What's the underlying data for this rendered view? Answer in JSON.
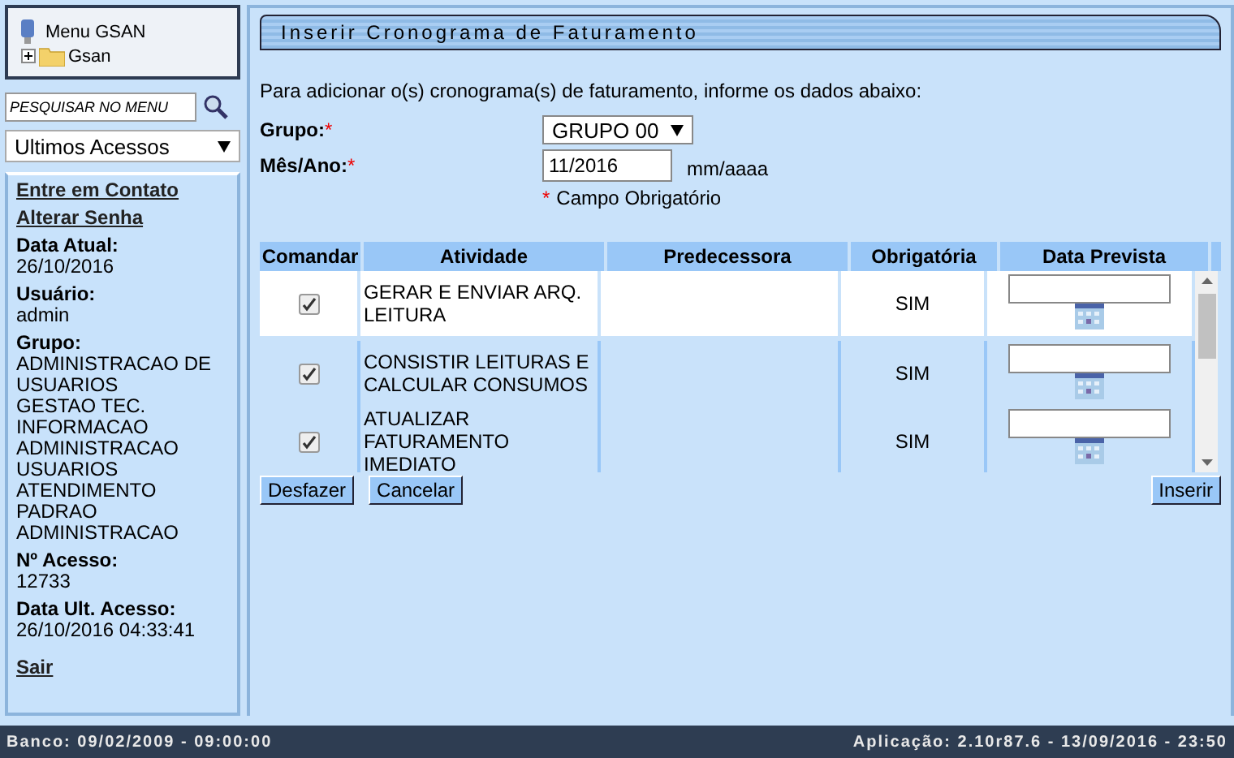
{
  "menu": {
    "title": "Menu GSAN",
    "tree": [
      {
        "label": "Gsan",
        "expanded": false
      }
    ]
  },
  "search": {
    "placeholder": "PESQUISAR NO MENU"
  },
  "recent": {
    "value": "Ultimos Acessos"
  },
  "links": [
    "Entre em Contato",
    "Alterar Senha"
  ],
  "info": [
    {
      "label": "Data Atual:",
      "lines": [
        "26/10/2016"
      ]
    },
    {
      "label": "Usuário:",
      "lines": [
        "admin"
      ]
    },
    {
      "label": "Grupo:",
      "lines": [
        "ADMINISTRACAO DE USUARIOS",
        "GESTAO TEC. INFORMACAO",
        "ADMINISTRACAO USUARIOS",
        "ATENDIMENTO PADRAO",
        "ADMINISTRACAO"
      ]
    },
    {
      "label": "Nº Acesso:",
      "lines": [
        "12733"
      ]
    },
    {
      "label": "Data Ult. Acesso:",
      "lines": [
        "26/10/2016 04:33:41"
      ]
    }
  ],
  "logout": "Sair",
  "page": {
    "title": "Inserir Cronograma de Faturamento",
    "intro": "Para adicionar o(s) cronograma(s) de faturamento, informe os dados abaixo:",
    "fields": [
      {
        "kind": "select",
        "label": "Grupo:",
        "required": true,
        "value": "GRUPO 00"
      },
      {
        "kind": "text",
        "label": "Mês/Ano:",
        "required": true,
        "value": "11/2016",
        "hint": "mm/aaaa"
      }
    ],
    "required_mark": "*",
    "required_note": "Campo Obrigatório"
  },
  "table": {
    "columns": [
      "Comandar",
      "Atividade",
      "Predecessora",
      "Obrigatória",
      "Data Prevista"
    ],
    "rows": [
      {
        "checked": true,
        "activity": "GERAR E ENVIAR ARQ. LEITURA",
        "mandatory": "SIM",
        "highlighted": true
      },
      {
        "checked": true,
        "activity": "CONSISTIR LEITURAS E CALCULAR CONSUMOS",
        "mandatory": "SIM",
        "highlighted": false
      },
      {
        "checked": true,
        "activity": "ATUALIZAR FATURAMENTO IMEDIATO",
        "mandatory": "SIM",
        "highlighted": false
      }
    ]
  },
  "buttons": {
    "left": [
      "Desfazer",
      "Cancelar"
    ],
    "right": [
      "Inserir"
    ]
  },
  "status_bar": {
    "left": "Banco: 09/02/2009 - 09:00:00",
    "right": "Aplicação: 2.10r87.6 - 13/09/2016 - 23:50"
  }
}
